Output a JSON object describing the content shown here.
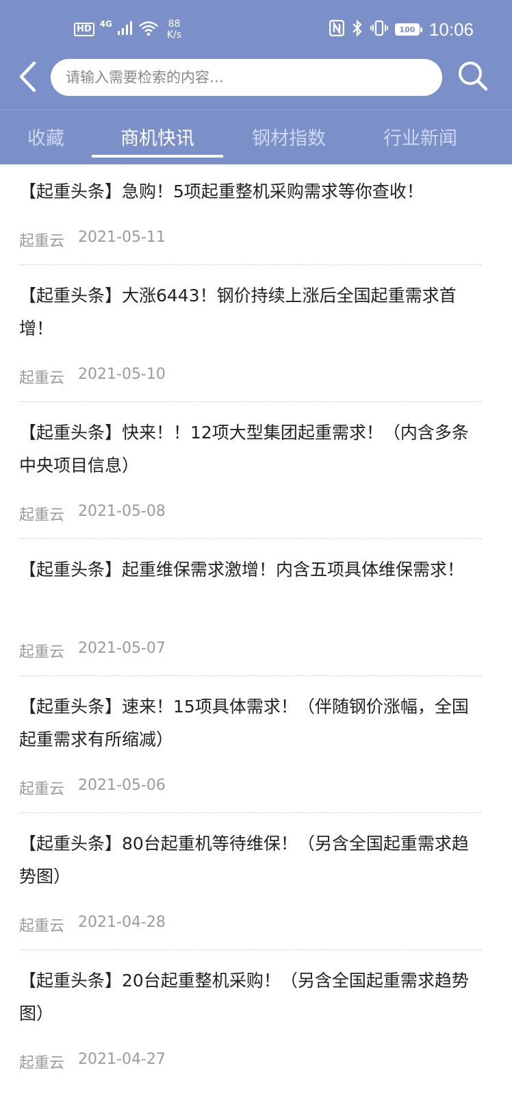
{
  "status_bar": {
    "hd_label": "HD",
    "network_type": "4G",
    "speed_value": "88",
    "speed_unit": "K/s",
    "battery_level": "100",
    "time": "10:06"
  },
  "search": {
    "placeholder": "请输入需要检索的内容…",
    "value": ""
  },
  "icons": {
    "back": "chevron-left-icon",
    "search": "search-icon"
  },
  "colors": {
    "header_bg": "#7b8fc9",
    "active_tab": "#ffffff",
    "inactive_tab": "#cfd7f0",
    "meta_text": "#9a9a9a"
  },
  "tabs": [
    {
      "label": "收藏",
      "active": false
    },
    {
      "label": "商机快讯",
      "active": true
    },
    {
      "label": "钢材指数",
      "active": false
    },
    {
      "label": "行业新闻",
      "active": false
    }
  ],
  "news": [
    {
      "title": "【起重头条】急购！5项起重整机采购需求等你查收！",
      "source": "起重云",
      "date": "2021-05-11"
    },
    {
      "title": "【起重头条】大涨6443！钢价持续上涨后全国起重需求首增！",
      "source": "起重云",
      "date": "2021-05-10"
    },
    {
      "title": "【起重头条】快来！！12项大型集团起重需求！（内含多条中央项目信息）",
      "source": "起重云",
      "date": "2021-05-08"
    },
    {
      "title": "【起重头条】起重维保需求激增！内含五项具体维保需求！",
      "source": "起重云",
      "date": "2021-05-07"
    },
    {
      "title": "【起重头条】速来！15项具体需求！（伴随钢价涨幅，全国起重需求有所缩减）",
      "source": "起重云",
      "date": "2021-05-06"
    },
    {
      "title": "【起重头条】80台起重机等待维保！（另含全国起重需求趋势图）",
      "source": "起重云",
      "date": "2021-04-28"
    },
    {
      "title": "【起重头条】20台起重整机采购！（另含全国起重需求趋势图）",
      "source": "起重云",
      "date": "2021-04-27"
    }
  ]
}
